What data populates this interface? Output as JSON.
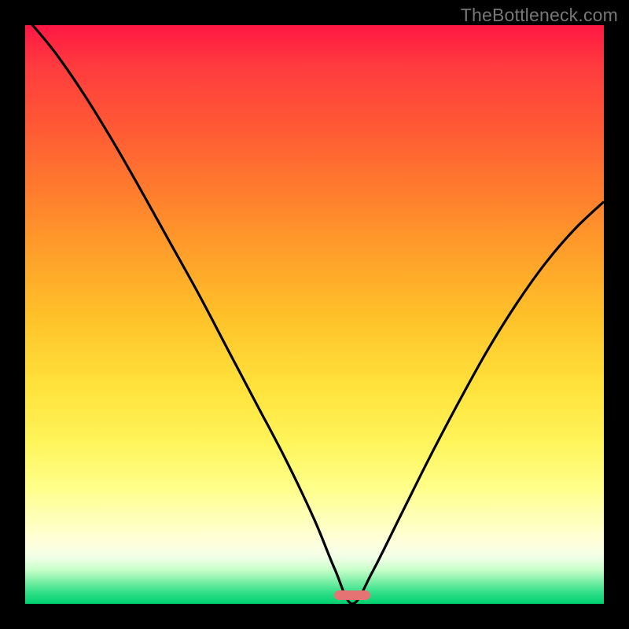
{
  "watermark": "TheBottleneck.com",
  "colors": {
    "background": "#000000",
    "curve": "#000000",
    "pill": "#e57373"
  },
  "marker": {
    "x_fraction": 0.565,
    "y_fraction": 0.985
  },
  "chart_data": {
    "type": "line",
    "title": "",
    "xlabel": "",
    "ylabel": "",
    "xlim": [
      0,
      1
    ],
    "ylim": [
      0,
      1
    ],
    "grid": false,
    "x": [
      0.0,
      0.05,
      0.1,
      0.15,
      0.2,
      0.25,
      0.3,
      0.35,
      0.4,
      0.45,
      0.5,
      0.535,
      0.565,
      0.6,
      0.65,
      0.7,
      0.75,
      0.8,
      0.85,
      0.9,
      0.95,
      1.0
    ],
    "values": [
      1.015,
      0.955,
      0.883,
      0.802,
      0.715,
      0.625,
      0.535,
      0.44,
      0.345,
      0.25,
      0.145,
      0.06,
      0.0,
      0.055,
      0.155,
      0.255,
      0.35,
      0.44,
      0.52,
      0.59,
      0.648,
      0.695
    ],
    "annotations": [
      {
        "text": "TheBottleneck.com",
        "position": "top-right"
      }
    ]
  }
}
